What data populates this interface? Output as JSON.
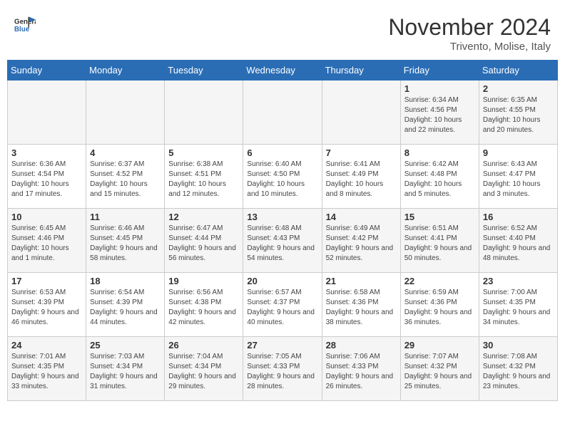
{
  "header": {
    "logo_line1": "General",
    "logo_line2": "Blue",
    "month": "November 2024",
    "location": "Trivento, Molise, Italy"
  },
  "weekdays": [
    "Sunday",
    "Monday",
    "Tuesday",
    "Wednesday",
    "Thursday",
    "Friday",
    "Saturday"
  ],
  "weeks": [
    [
      {
        "day": "",
        "info": ""
      },
      {
        "day": "",
        "info": ""
      },
      {
        "day": "",
        "info": ""
      },
      {
        "day": "",
        "info": ""
      },
      {
        "day": "",
        "info": ""
      },
      {
        "day": "1",
        "info": "Sunrise: 6:34 AM\nSunset: 4:56 PM\nDaylight: 10 hours and 22 minutes."
      },
      {
        "day": "2",
        "info": "Sunrise: 6:35 AM\nSunset: 4:55 PM\nDaylight: 10 hours and 20 minutes."
      }
    ],
    [
      {
        "day": "3",
        "info": "Sunrise: 6:36 AM\nSunset: 4:54 PM\nDaylight: 10 hours and 17 minutes."
      },
      {
        "day": "4",
        "info": "Sunrise: 6:37 AM\nSunset: 4:52 PM\nDaylight: 10 hours and 15 minutes."
      },
      {
        "day": "5",
        "info": "Sunrise: 6:38 AM\nSunset: 4:51 PM\nDaylight: 10 hours and 12 minutes."
      },
      {
        "day": "6",
        "info": "Sunrise: 6:40 AM\nSunset: 4:50 PM\nDaylight: 10 hours and 10 minutes."
      },
      {
        "day": "7",
        "info": "Sunrise: 6:41 AM\nSunset: 4:49 PM\nDaylight: 10 hours and 8 minutes."
      },
      {
        "day": "8",
        "info": "Sunrise: 6:42 AM\nSunset: 4:48 PM\nDaylight: 10 hours and 5 minutes."
      },
      {
        "day": "9",
        "info": "Sunrise: 6:43 AM\nSunset: 4:47 PM\nDaylight: 10 hours and 3 minutes."
      }
    ],
    [
      {
        "day": "10",
        "info": "Sunrise: 6:45 AM\nSunset: 4:46 PM\nDaylight: 10 hours and 1 minute."
      },
      {
        "day": "11",
        "info": "Sunrise: 6:46 AM\nSunset: 4:45 PM\nDaylight: 9 hours and 58 minutes."
      },
      {
        "day": "12",
        "info": "Sunrise: 6:47 AM\nSunset: 4:44 PM\nDaylight: 9 hours and 56 minutes."
      },
      {
        "day": "13",
        "info": "Sunrise: 6:48 AM\nSunset: 4:43 PM\nDaylight: 9 hours and 54 minutes."
      },
      {
        "day": "14",
        "info": "Sunrise: 6:49 AM\nSunset: 4:42 PM\nDaylight: 9 hours and 52 minutes."
      },
      {
        "day": "15",
        "info": "Sunrise: 6:51 AM\nSunset: 4:41 PM\nDaylight: 9 hours and 50 minutes."
      },
      {
        "day": "16",
        "info": "Sunrise: 6:52 AM\nSunset: 4:40 PM\nDaylight: 9 hours and 48 minutes."
      }
    ],
    [
      {
        "day": "17",
        "info": "Sunrise: 6:53 AM\nSunset: 4:39 PM\nDaylight: 9 hours and 46 minutes."
      },
      {
        "day": "18",
        "info": "Sunrise: 6:54 AM\nSunset: 4:39 PM\nDaylight: 9 hours and 44 minutes."
      },
      {
        "day": "19",
        "info": "Sunrise: 6:56 AM\nSunset: 4:38 PM\nDaylight: 9 hours and 42 minutes."
      },
      {
        "day": "20",
        "info": "Sunrise: 6:57 AM\nSunset: 4:37 PM\nDaylight: 9 hours and 40 minutes."
      },
      {
        "day": "21",
        "info": "Sunrise: 6:58 AM\nSunset: 4:36 PM\nDaylight: 9 hours and 38 minutes."
      },
      {
        "day": "22",
        "info": "Sunrise: 6:59 AM\nSunset: 4:36 PM\nDaylight: 9 hours and 36 minutes."
      },
      {
        "day": "23",
        "info": "Sunrise: 7:00 AM\nSunset: 4:35 PM\nDaylight: 9 hours and 34 minutes."
      }
    ],
    [
      {
        "day": "24",
        "info": "Sunrise: 7:01 AM\nSunset: 4:35 PM\nDaylight: 9 hours and 33 minutes."
      },
      {
        "day": "25",
        "info": "Sunrise: 7:03 AM\nSunset: 4:34 PM\nDaylight: 9 hours and 31 minutes."
      },
      {
        "day": "26",
        "info": "Sunrise: 7:04 AM\nSunset: 4:34 PM\nDaylight: 9 hours and 29 minutes."
      },
      {
        "day": "27",
        "info": "Sunrise: 7:05 AM\nSunset: 4:33 PM\nDaylight: 9 hours and 28 minutes."
      },
      {
        "day": "28",
        "info": "Sunrise: 7:06 AM\nSunset: 4:33 PM\nDaylight: 9 hours and 26 minutes."
      },
      {
        "day": "29",
        "info": "Sunrise: 7:07 AM\nSunset: 4:32 PM\nDaylight: 9 hours and 25 minutes."
      },
      {
        "day": "30",
        "info": "Sunrise: 7:08 AM\nSunset: 4:32 PM\nDaylight: 9 hours and 23 minutes."
      }
    ]
  ]
}
